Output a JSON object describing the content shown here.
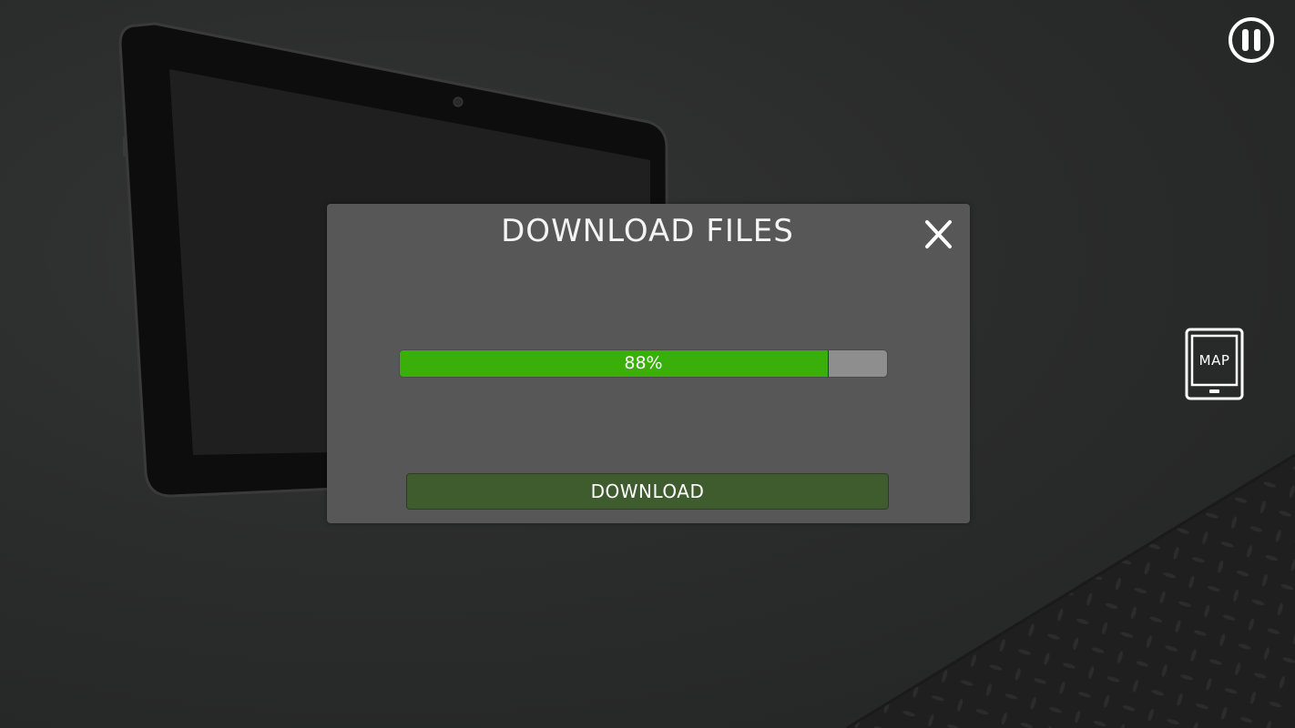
{
  "hud": {
    "pause_icon": "pause-icon",
    "map_label": "MAP",
    "map_icon": "tablet-icon"
  },
  "dialog": {
    "title": "DOWNLOAD FILES",
    "close_icon": "close-icon",
    "progress_percent": 88,
    "progress_label": "88%",
    "download_label": "DOWNLOAD"
  },
  "colors": {
    "dialog_bg": "#575757",
    "progress_fill": "#3aae09",
    "progress_track": "#8e8e8e",
    "download_button": "#3f5c2f"
  }
}
